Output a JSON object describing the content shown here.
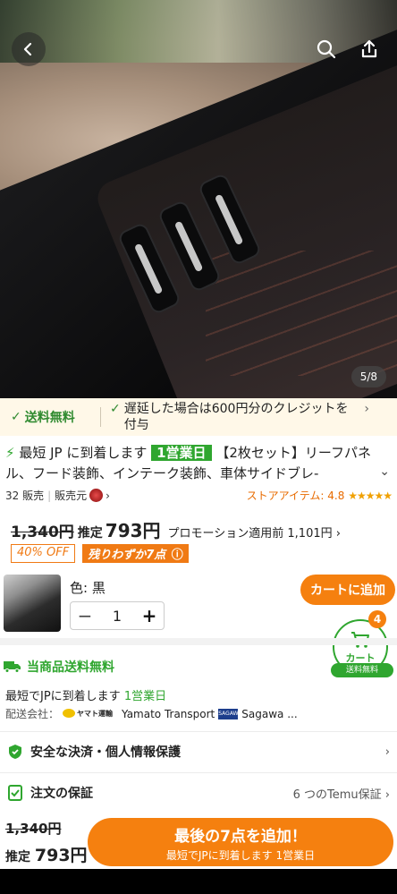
{
  "hero": {
    "page_indicator": "5/8",
    "back_icon": "back-arrow-icon",
    "search_icon": "search-icon",
    "share_icon": "share-icon"
  },
  "banner": {
    "free_shipping": "送料無料",
    "credit": "遅延した場合は600円分のクレジットを付与"
  },
  "product": {
    "fast_prefix": "最短 JP に到着します",
    "fast_badge": "1営業日",
    "title": "【2枚セット】リーフパネル、フード装飾、インテーク装飾、車体サイドブレ-",
    "sales": "32 販売",
    "seller_label": "販売元",
    "store_rating": "ストアアイテム: 4.8",
    "stars": "★★★★★"
  },
  "price": {
    "original": "1,340円",
    "estimate_label": "推定",
    "current": "793円",
    "promo": "プロモーション適用前 1,101円",
    "off_tag": "40% OFF",
    "stock_tag": "残りわずか7点"
  },
  "variant": {
    "color": "色: 黒",
    "qty": "1",
    "minus": "−",
    "plus": "+",
    "add_to_cart": "カートに追加"
  },
  "cart": {
    "count": "4",
    "label": "カート",
    "free": "送料無料"
  },
  "shipping": {
    "title": "当商品送料無料",
    "arrival_prefix": "最短でJPに到着します",
    "arrival_days": "1営業日",
    "carrier_label": "配送会社：",
    "yamato_logo": "ヤマト運輸",
    "carrier1": "Yamato Transport",
    "sagawa_logo": "SAGAWA",
    "carrier2": "Sagawa ..."
  },
  "rows": {
    "security": "安全な決済・個人情報保護",
    "guarantee": "注文の保証",
    "guarantee_right": "6 つのTemu保証"
  },
  "bottom": {
    "original": "1,340円",
    "estimate_label": "推定",
    "current": "793円",
    "cta_main": "最後の7点を追加！",
    "cta_sub": "最短でJPに到着します 1営業日"
  },
  "colors": {
    "accent_orange": "#f5800f",
    "accent_green": "#2fa62f"
  }
}
